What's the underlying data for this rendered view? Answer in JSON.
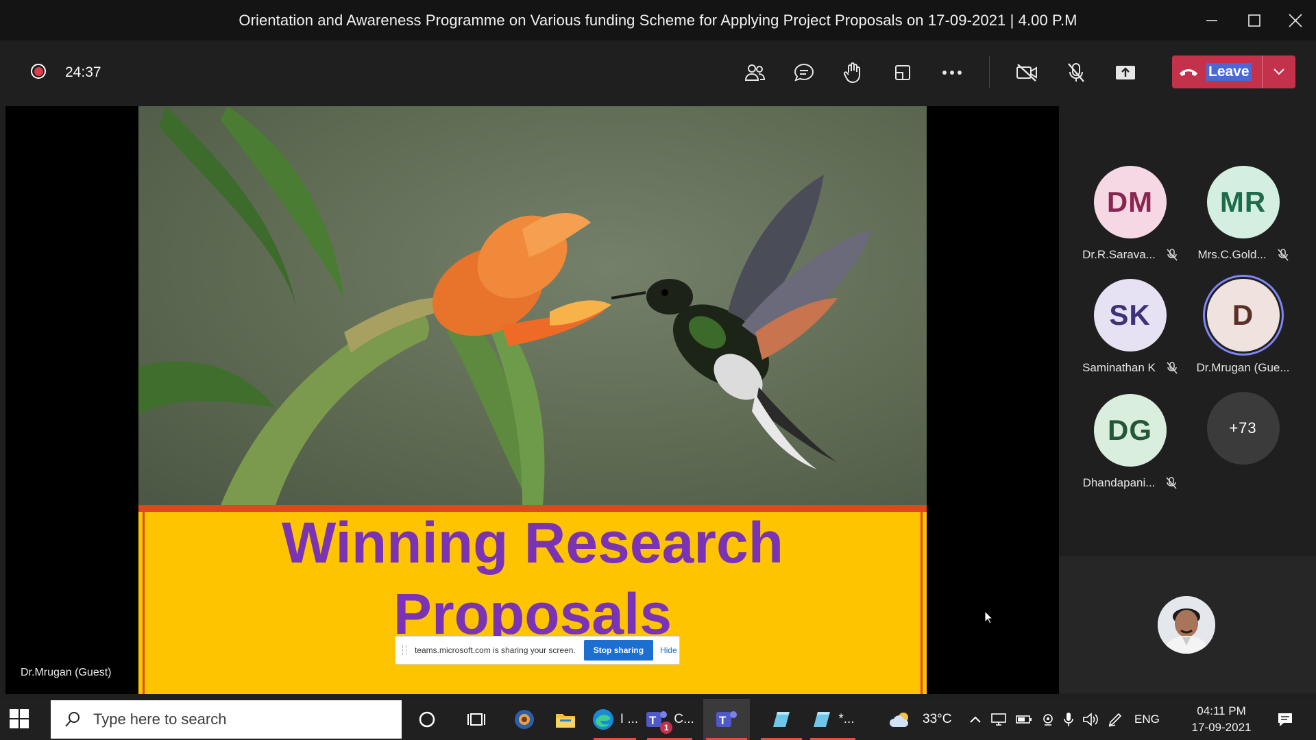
{
  "window": {
    "title": "Orientation and Awareness Programme on Various funding Scheme for Applying Project Proposals on 17-09-2021 | 4.00 P.M",
    "minimize_icon": "minimize-icon",
    "maximize_icon": "maximize-icon",
    "close_icon": "close-icon"
  },
  "toolbar": {
    "recording_icon": "recording-icon",
    "timer": "24:37",
    "buttons": [
      "people-icon",
      "chat-icon",
      "raise-hand-icon",
      "share-tray-icon",
      "more-icon",
      "camera-off-icon",
      "mic-off-icon",
      "share-screen-icon"
    ],
    "leave_label": "Leave",
    "leave_color": "#c4314b"
  },
  "stage": {
    "slide_title_line1": "Winning Research",
    "slide_title_line2": "Proposals",
    "share_message": "teams.microsoft.com is sharing your screen.",
    "stop_sharing_label": "Stop sharing",
    "hide_label": "Hide",
    "presenter_name": "Dr.Mrugan (Guest)",
    "slide_title_color": "#7a33b4",
    "band_color": "#ffc400"
  },
  "participants": [
    {
      "initials": "DM",
      "name": "Dr.R.Sarava...",
      "muted": true,
      "bg": "#f6d8e4",
      "fg": "#8a2450"
    },
    {
      "initials": "MR",
      "name": "Mrs.C.Gold...",
      "muted": true,
      "bg": "#d4efe1",
      "fg": "#1d6b48"
    },
    {
      "initials": "SK",
      "name": "Saminathan K",
      "muted": true,
      "bg": "#e6e2f3",
      "fg": "#3d3277"
    },
    {
      "initials": "D",
      "name": "Dr.Mrugan (Gue...",
      "muted": false,
      "speaking": true,
      "bg": "#efe2df",
      "fg": "#5a2f27"
    },
    {
      "initials": "DG",
      "name": "Dhandapani...",
      "muted": true,
      "bg": "#d9eedd",
      "fg": "#24573a"
    },
    {
      "initials": "+73",
      "name": "",
      "muted": false,
      "bg": "#3b3b3b",
      "fg": "#ffffff"
    }
  ],
  "taskbar": {
    "search_placeholder": "Type here to search",
    "apps": [
      {
        "icon": "cortana-icon",
        "label": ""
      },
      {
        "icon": "task-view-icon",
        "label": ""
      },
      {
        "icon": "browser-globe-icon",
        "label": ""
      },
      {
        "icon": "file-explorer-icon",
        "label": ""
      },
      {
        "icon": "edge-icon",
        "label": "I ..."
      },
      {
        "icon": "teams-icon",
        "label": "C...",
        "badge": "1"
      },
      {
        "icon": "teams-active-icon",
        "label": ""
      },
      {
        "icon": "notepad-icon",
        "label": ""
      },
      {
        "icon": "notepad-icon",
        "label": "*..."
      }
    ],
    "weather_temp": "33°C",
    "language": "ENG",
    "time": "04:11 PM",
    "date": "17-09-2021"
  }
}
